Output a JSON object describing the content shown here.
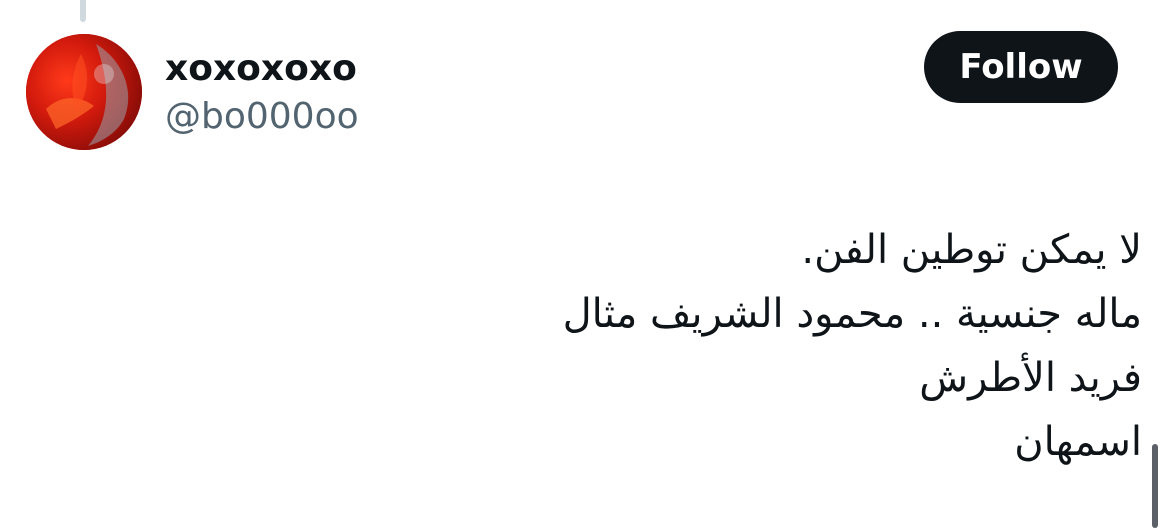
{
  "author": {
    "display_name": "xoxoxoxo",
    "handle": "@bo000oo"
  },
  "actions": {
    "follow_label": "Follow"
  },
  "tweet": {
    "lines": [
      "لا يمكن توطين الفن.",
      "ماله جنسية .. محمود الشريف مثال",
      "فريد الأطرش",
      "اسمهان"
    ]
  },
  "colors": {
    "follow_button_bg": "#0f1419",
    "handle_text": "#536471",
    "primary_text": "#0f1419",
    "thread_line": "#cfd9de"
  },
  "icons": {
    "avatar": "profile-avatar-red-abstract"
  }
}
